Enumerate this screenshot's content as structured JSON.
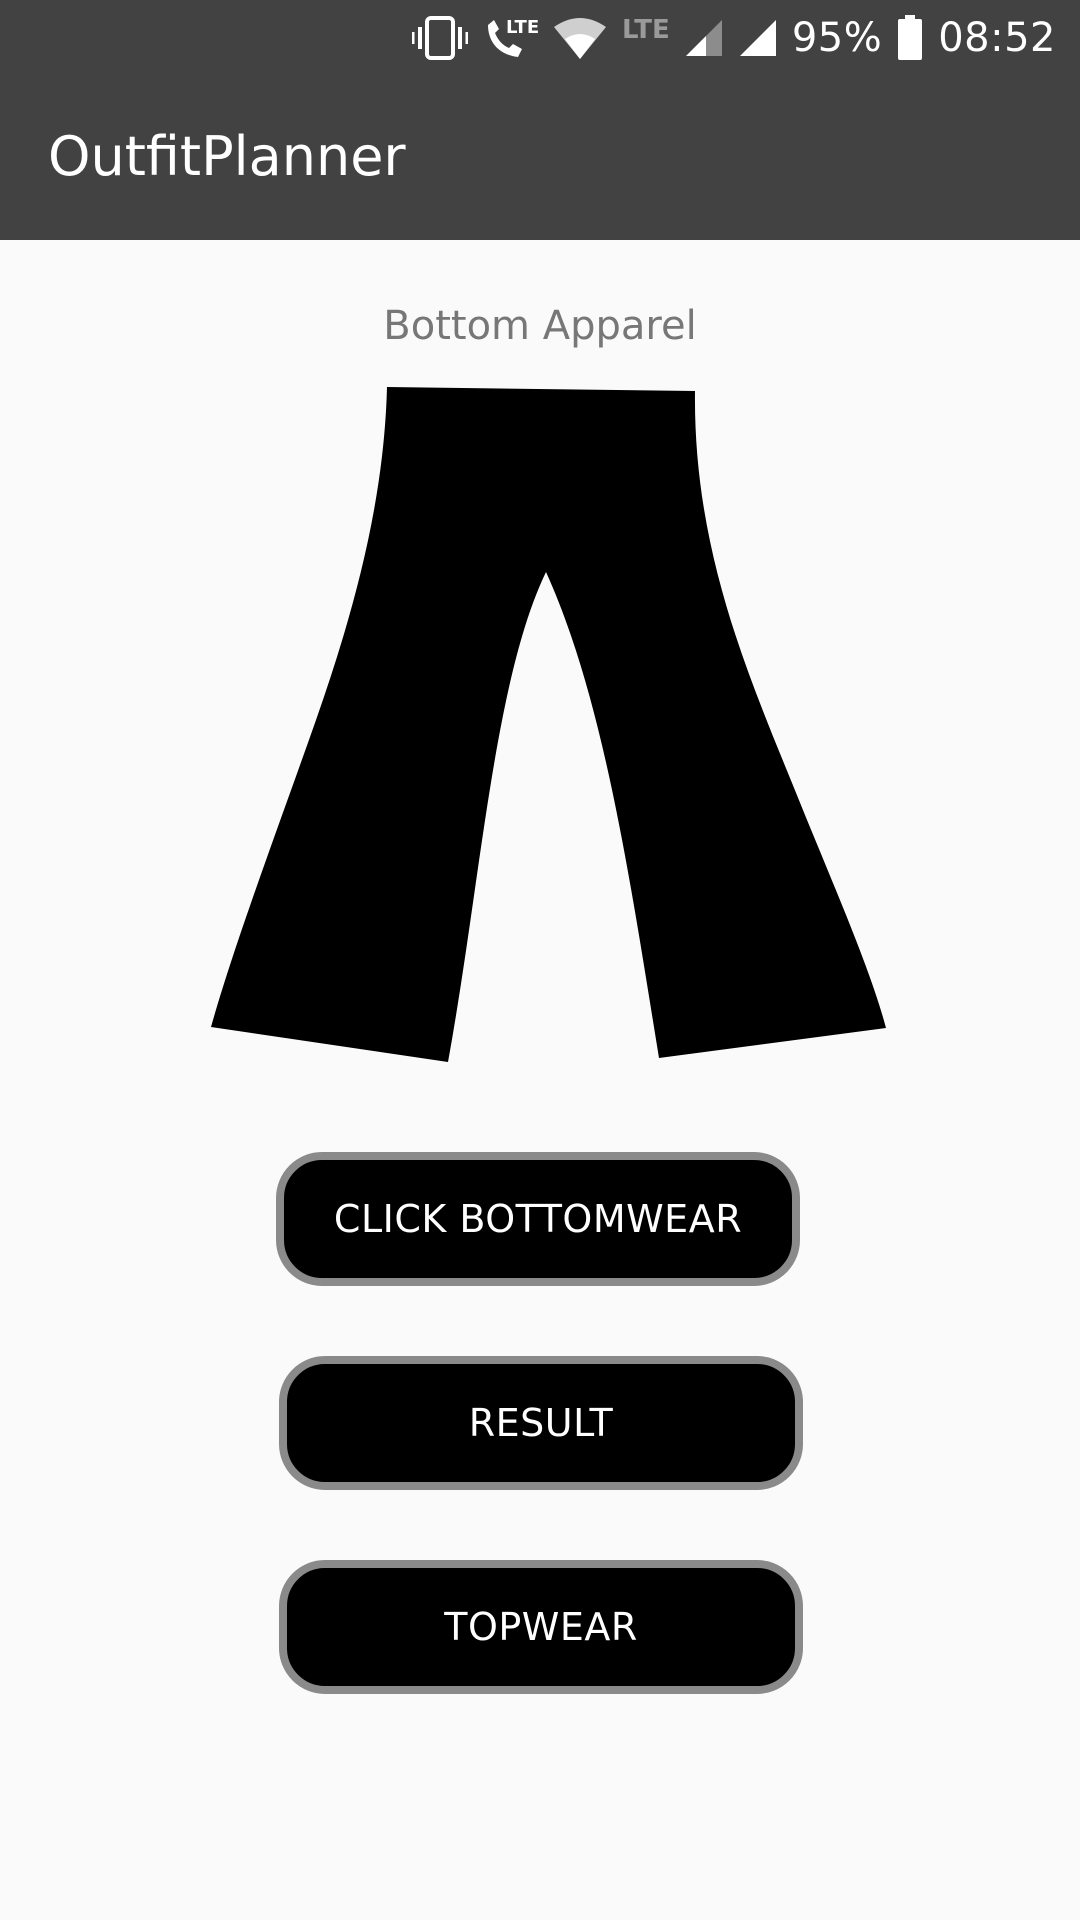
{
  "status_bar": {
    "battery_percent": "95%",
    "time": "08:52",
    "network_label": "LTE",
    "call_network_label": "LTE",
    "icons": [
      "vibrate-icon",
      "lte-call-icon",
      "wifi-icon",
      "signal-icon",
      "signal-icon",
      "battery-icon"
    ]
  },
  "app_bar": {
    "title": "OutfitPlanner"
  },
  "main": {
    "section_label": "Bottom Apparel",
    "image_icon": "pants-icon",
    "buttons": [
      {
        "label": "CLICK BOTTOMWEAR"
      },
      {
        "label": "RESULT"
      },
      {
        "label": "TOPWEAR"
      }
    ]
  },
  "colors": {
    "app_bar": "#424242",
    "background": "#fafafa",
    "button_fill": "#000000",
    "button_border": "#8a8a8a",
    "label_text": "#777777"
  }
}
